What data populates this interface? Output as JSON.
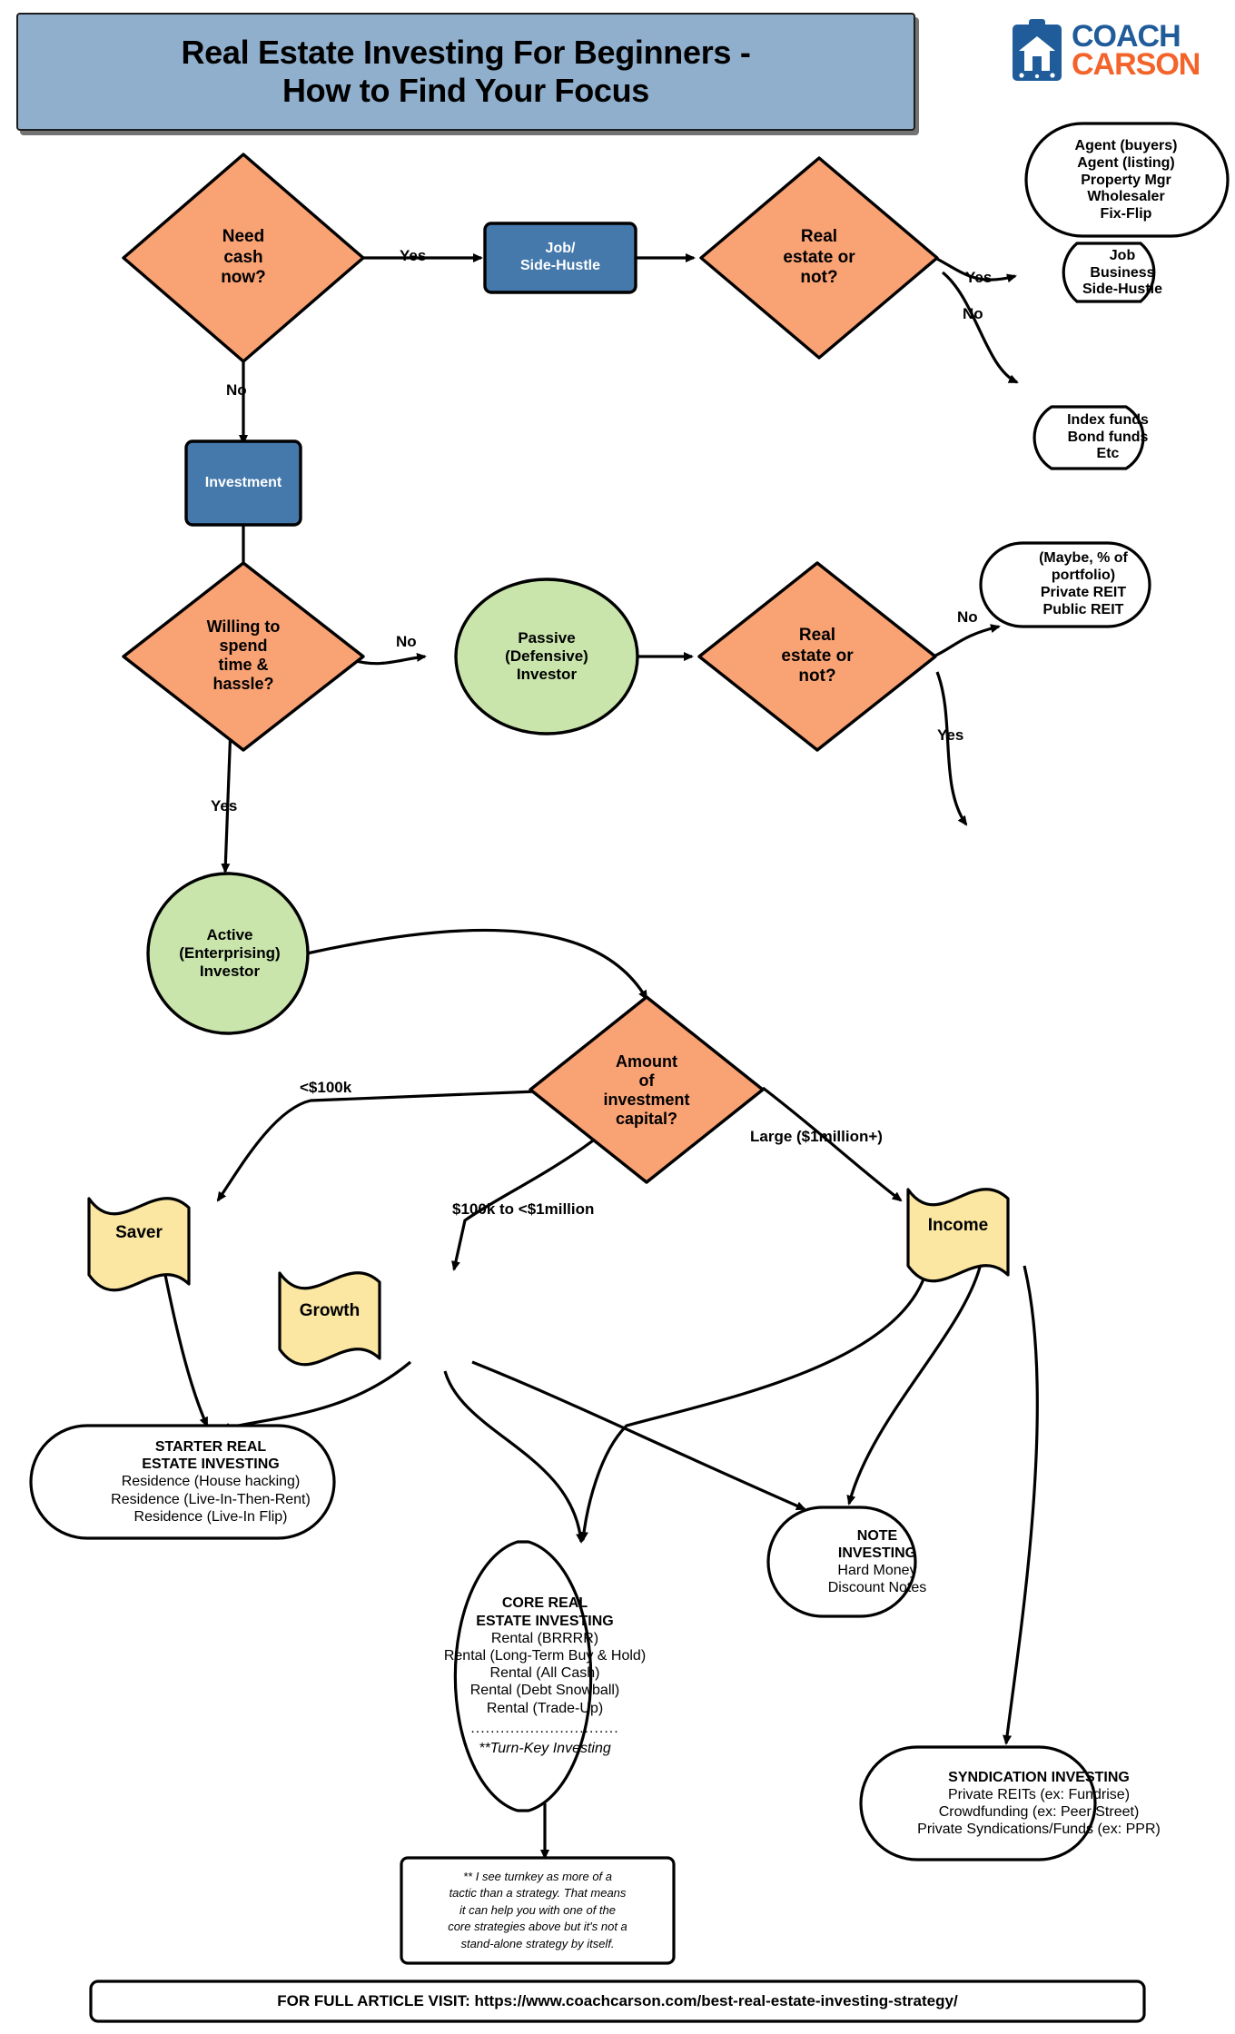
{
  "header": {
    "title_line1": "Real Estate Investing For Beginners -",
    "title_line2": "How to Find Your Focus",
    "banner_color": "#8FAFCD"
  },
  "logo": {
    "word1": "COACH",
    "word2": "CARSON",
    "color1": "#1F5C99",
    "color2": "#F4632A",
    "icon": "clipboard-house-icon"
  },
  "palette": {
    "decision": "#F9A274",
    "process": "#4579AB",
    "terminator": "#C9E5AC",
    "banner": "#FBE7A2",
    "outline": "#000000"
  },
  "nodes": {
    "need_cash": "Need\ncash\nnow?",
    "job_side_hustle": "Job/\nSide-Hustle",
    "real_estate_1": "Real\nestate or\nnot?",
    "agent_list": "Agent (buyers)\nAgent (listing)\nProperty Mgr\nWholesaler\nFix-Flip",
    "job_business": "Job\nBusiness\nSide-Hustle",
    "investment": "Investment",
    "willing_time": "Willing to\nspend\ntime &\nhassle?",
    "passive_investor": "Passive\n(Defensive)\nInvestor",
    "real_estate_2": "Real\nestate or\nnot?",
    "index_funds": "Index funds\nBond funds\nEtc",
    "reits": "(Maybe, % of\nportfolio)\nPrivate REIT\nPublic REIT",
    "active_investor": "Active\n(Enterprising)\nInvestor",
    "amount_capital": "Amount\nof\ninvestment\ncapital?",
    "saver": "Saver",
    "growth": "Growth",
    "income": "Income"
  },
  "edge_labels": {
    "yes_1": "Yes",
    "no_1": "No",
    "yes_2": "Yes",
    "no_2": "No",
    "no_3": "No",
    "yes_3": "Yes",
    "no_4": "No",
    "yes_4": "Yes",
    "under_100k": "<$100k",
    "mid_range": "$100k to <$1million",
    "large": "Large ($1million+)"
  },
  "outcome_boxes": {
    "starter": {
      "heading": [
        "STARTER REAL",
        "ESTATE INVESTING"
      ],
      "items": [
        "Residence (House hacking)",
        "Residence (Live-In-Then-Rent)",
        "Residence (Live-In Flip)"
      ]
    },
    "core": {
      "heading": [
        "CORE REAL",
        "ESTATE INVESTING"
      ],
      "items": [
        "Rental (BRRRR)",
        "Rental (Long-Term Buy & Hold)",
        "Rental (All Cash)",
        "Rental (Debt Snowball)",
        "Rental (Trade-Up)"
      ],
      "divider": "..............................",
      "footnote": "**Turn-Key Investing"
    },
    "note": {
      "heading": [
        "NOTE",
        "INVESTING"
      ],
      "items": [
        "Hard Money",
        "Discount Notes"
      ]
    },
    "syndication": {
      "heading": [
        "SYNDICATION INVESTING"
      ],
      "items": [
        "Private REITs (ex: Fundrise)",
        "Crowdfunding (ex: Peer Street)",
        "Private Syndications/Funds (ex: PPR)"
      ]
    },
    "turnkey_note": {
      "lines": [
        "** I see turnkey as more of a",
        "tactic than a strategy. That means",
        "it can help you with one of the",
        "core strategies above but it's not a",
        "stand-alone strategy by itself."
      ]
    }
  },
  "footer": {
    "text": "FOR FULL ARTICLE VISIT: https://www.coachcarson.com/best-real-estate-investing-strategy/"
  }
}
